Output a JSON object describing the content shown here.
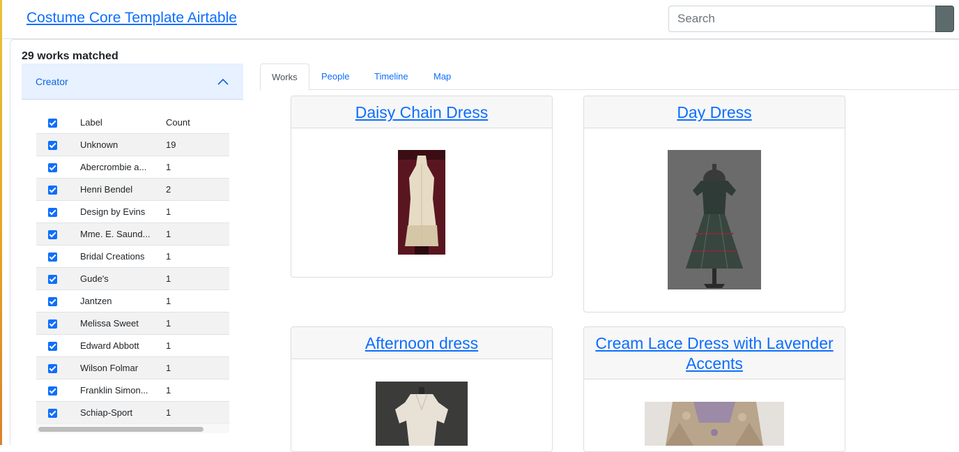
{
  "header": {
    "site_title": "Costume Core Template Airtable",
    "search_placeholder": "Search"
  },
  "results": {
    "matched_text": "29 works matched"
  },
  "facet": {
    "title": "Creator",
    "columns": {
      "label": "Label",
      "count": "Count"
    },
    "rows": [
      {
        "label": "Unknown",
        "count": "19"
      },
      {
        "label": "Abercrombie a...",
        "count": "1"
      },
      {
        "label": "Henri Bendel",
        "count": "2"
      },
      {
        "label": "Design by Evins",
        "count": "1"
      },
      {
        "label": "Mme. E. Saund...",
        "count": "1"
      },
      {
        "label": "Bridal Creations",
        "count": "1"
      },
      {
        "label": "Gude's",
        "count": "1"
      },
      {
        "label": "Jantzen",
        "count": "1"
      },
      {
        "label": "Melissa Sweet",
        "count": "1"
      },
      {
        "label": "Edward Abbott",
        "count": "1"
      },
      {
        "label": "Wilson Folmar",
        "count": "1"
      },
      {
        "label": "Franklin Simon...",
        "count": "1"
      },
      {
        "label": "Schiap-Sport",
        "count": "1"
      }
    ]
  },
  "tabs": [
    {
      "label": "Works",
      "active": true
    },
    {
      "label": "People",
      "active": false
    },
    {
      "label": "Timeline",
      "active": false
    },
    {
      "label": "Map",
      "active": false
    }
  ],
  "works": [
    {
      "title": "Daisy Chain Dress"
    },
    {
      "title": "Day Dress"
    },
    {
      "title": "Afternoon dress"
    },
    {
      "title": "Cream Lace Dress with Lavender Accents"
    }
  ],
  "colors": {
    "link": "#0d6efd",
    "accordion_bg": "#e7f1ff",
    "checkbox": "#0d6efd",
    "search_button": "#5d6b6c"
  }
}
